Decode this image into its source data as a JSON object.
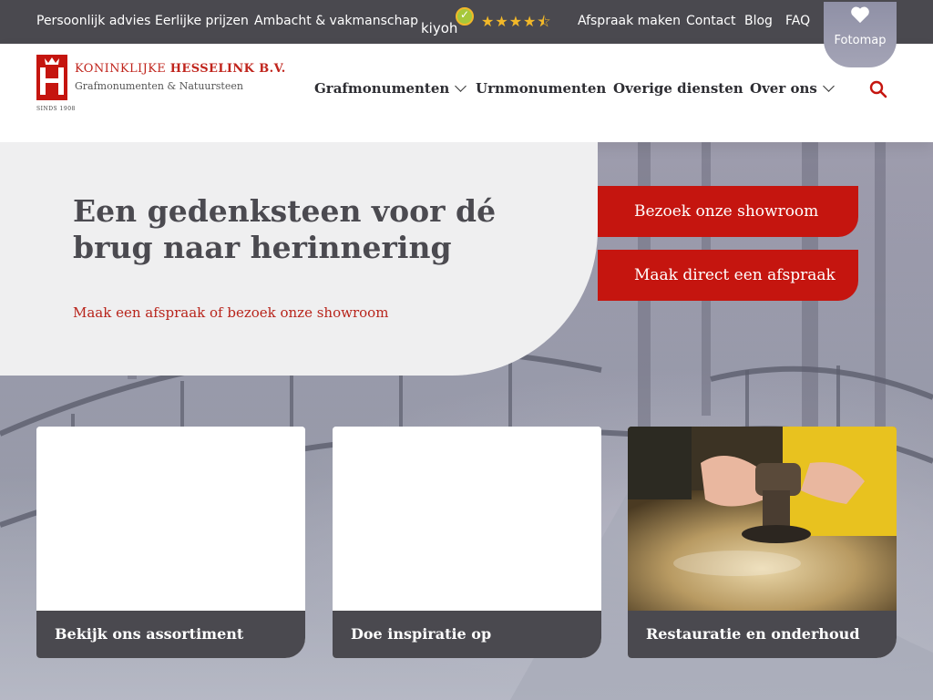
{
  "topbar": {
    "links": [
      "Persoonlijk advies",
      "Eerlijke prijzen",
      "Ambacht & vakmanschap"
    ],
    "kiyoh": "kiyoh",
    "stars": "★★★★⯪",
    "right_links": [
      "Afspraak maken",
      "Contact",
      "Blog",
      "FAQ"
    ],
    "fotomap": "Fotomap"
  },
  "logo": {
    "name_part1": "KONINKLIJKE ",
    "name_part2": "HESSELINK B.V.",
    "subtitle": "Grafmonumenten & Natuursteen",
    "since": "SINDS 1908"
  },
  "nav": {
    "items": [
      "Grafmonumenten",
      "Urnmonumenten",
      "Overige diensten",
      "Over ons"
    ]
  },
  "hero": {
    "title": "Een gedenksteen voor dé brug naar herinnering",
    "subtitle": "Maak een afspraak of bezoek onze showroom",
    "cta_showroom": "Bezoek onze showroom",
    "cta_appointment": "Maak direct een afspraak"
  },
  "cards": [
    {
      "caption": "Bekijk ons assortiment"
    },
    {
      "caption": "Doe inspiratie op"
    },
    {
      "caption": "Restauratie en onderhoud"
    }
  ],
  "colors": {
    "brand_red": "#c5150f",
    "topbar": "#4a494f",
    "hero_bg": "#efeff0",
    "star": "#f2b829"
  },
  "icons": {
    "heart": "heart-icon",
    "search": "search-icon",
    "chevron": "chevron-down-icon"
  }
}
